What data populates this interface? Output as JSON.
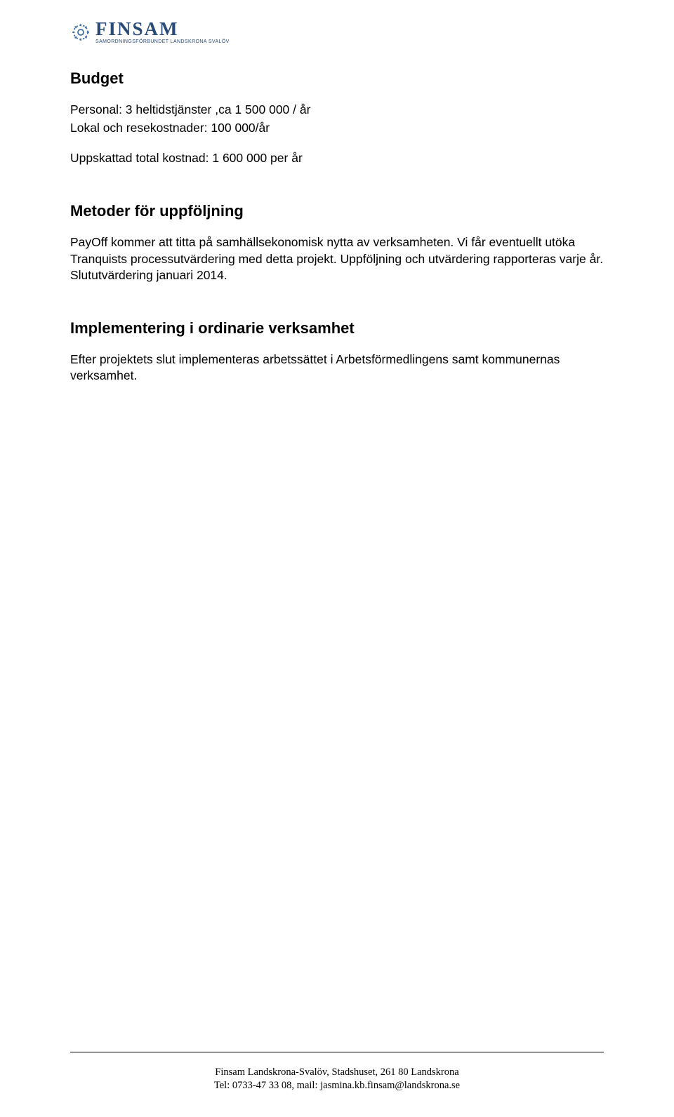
{
  "logo": {
    "name": "FINSAM",
    "subtitle": "SAMORDNINGSFÖRBUNDET LANDSKRONA SVALÖV"
  },
  "sections": {
    "budget": {
      "heading": "Budget",
      "line1": "Personal: 3 heltidstjänster ,ca 1 500 000 / år",
      "line2": "Lokal och resekostnader: 100 000/år",
      "line3": "Uppskattad  total kostnad: 1 600 000 per år"
    },
    "methods": {
      "heading": "Metoder för uppföljning",
      "para": "PayOff kommer att titta på samhällsekonomisk nytta av verksamheten. Vi får eventuellt utöka Tranquists processutvärdering med detta projekt. Uppföljning och utvärdering rapporteras varje år. Slututvärdering januari 2014."
    },
    "impl": {
      "heading": "Implementering i ordinarie verksamhet",
      "para": "Efter projektets slut implementeras arbetssättet i Arbetsförmedlingens samt kommunernas verksamhet."
    }
  },
  "footer": {
    "line1": "Finsam Landskrona-Svalöv, Stadshuset, 261 80 Landskrona",
    "line2": "Tel: 0733-47 33 08, mail: jasmina.kb.finsam@landskrona.se"
  }
}
